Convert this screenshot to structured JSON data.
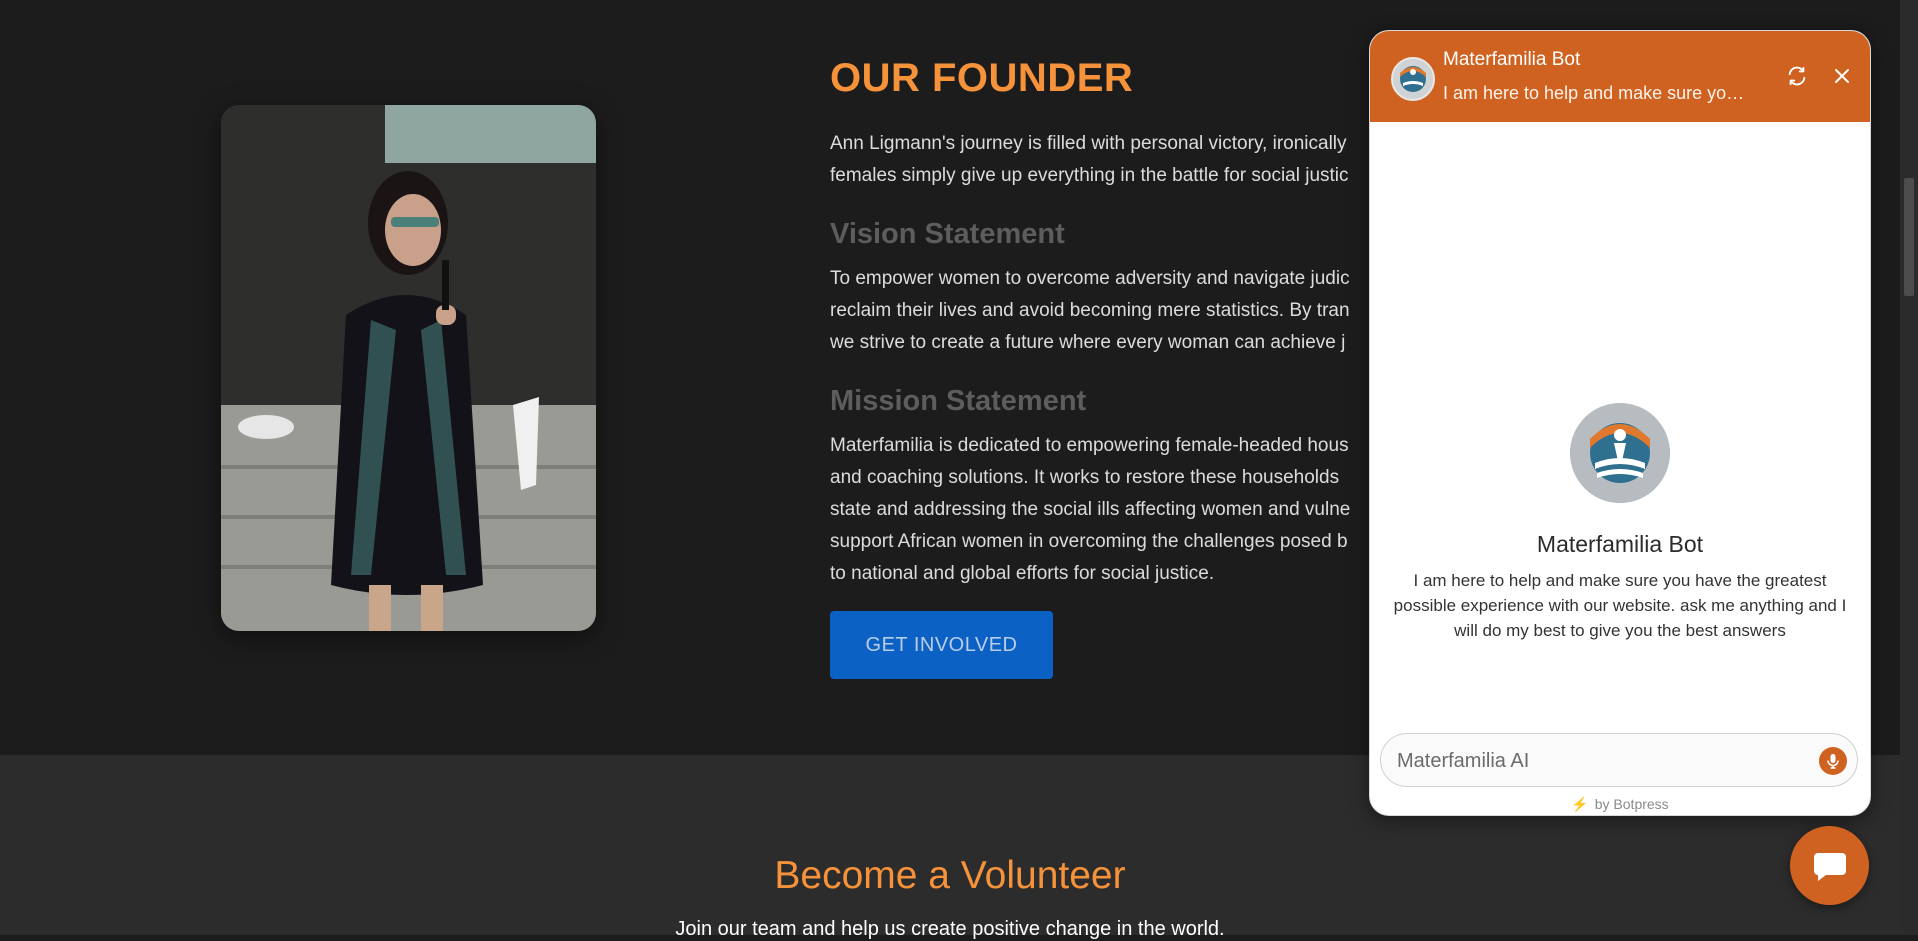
{
  "founder": {
    "title": "OUR FOUNDER",
    "intro": [
      "Ann Ligmann's journey is filled with personal victory, ironically",
      "females simply give up everything in the battle for social justic"
    ],
    "vision_heading": "Vision Statement",
    "vision": [
      "To empower women to overcome adversity and navigate judic",
      "reclaim their lives and avoid becoming mere statistics. By tran",
      "we strive to create a future where every woman can achieve j"
    ],
    "mission_heading": "Mission Statement",
    "mission": [
      "Materfamilia is dedicated to empowering female-headed hous",
      "and coaching solutions. It works to restore these households",
      "state and addressing the social ills affecting women and vulne",
      "support African women in overcoming the challenges posed b",
      "to national and global efforts for social justice."
    ],
    "cta_label": "GET INVOLVED"
  },
  "volunteer": {
    "title": "Become a Volunteer",
    "subtitle": "Join our team and help us create positive change in the world."
  },
  "chat": {
    "bot_name": "Materfamilia Bot",
    "header_subtitle": "I am here to help and make sure you have the greatest possible experience with our website.",
    "description": "I am here to help and make sure you have the greatest possible experience with our website. ask me anything and I will do my best to give you the best answers",
    "input_placeholder": "Materfamilia AI",
    "powered_by": "by Botpress",
    "accent_color": "#cf6220"
  },
  "icons": {
    "refresh": "refresh-icon",
    "close": "close-icon",
    "mic": "microphone-icon",
    "launcher": "chat-bubble-icon",
    "bolt": "lightning-icon"
  }
}
